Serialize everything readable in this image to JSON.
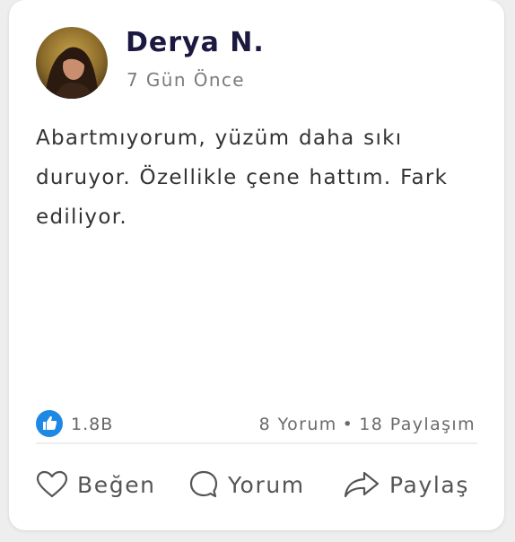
{
  "post": {
    "author": "Derya N.",
    "time": "7 Gün Önce",
    "text": "Abartmıyorum, yüzüm daha sıkı duruyor. Özellikle çene hattım. Fark ediliyor.",
    "avatar_icon": "profile-photo"
  },
  "reactions": {
    "icon": "thumbs-up-icon",
    "count": "1.8B",
    "comments": "8 Yorum",
    "separator": "•",
    "shares": "18 Paylaşım"
  },
  "actions": {
    "like_label": "Beğen",
    "comment_label": "Yorum",
    "share_label": "Paylaş"
  },
  "colors": {
    "name": "#1c1940",
    "accent": "#1e88e5",
    "muted": "#7b7b7b"
  }
}
